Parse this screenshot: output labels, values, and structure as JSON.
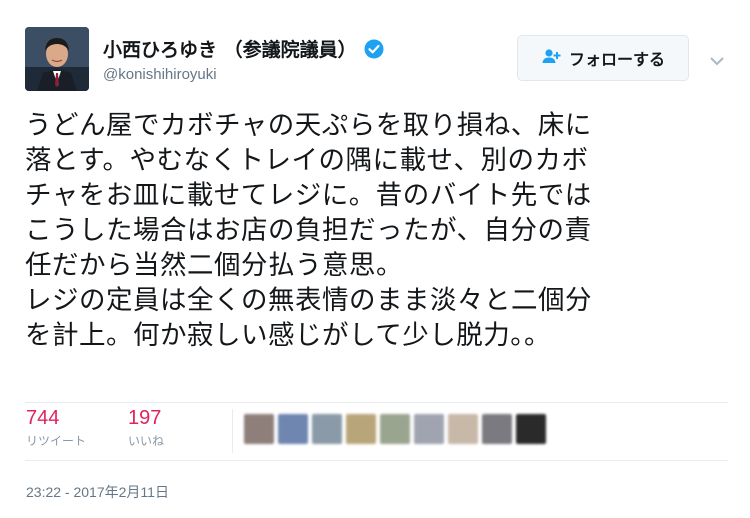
{
  "user": {
    "name": "小西ひろゆき （参議院議員）",
    "handle": "@konishihiroyuki",
    "verified": true
  },
  "follow_button": {
    "label": "フォローする",
    "icon": "add-user-icon"
  },
  "tweet": {
    "lines": [
      "うどん屋でカボチャの天ぷらを取り損ね、床に",
      "落とす。やむなくトレイの隅に載せ、別のカボ",
      "チャをお皿に載せてレジに。昔のバイト先では",
      "こうした場合はお店の負担だったが、自分の責",
      "任だから当然二個分払う意思。",
      "レジの定員は全くの無表情のまま淡々と二個分",
      "を計上。何か寂しい感じがして少し脱力。。"
    ]
  },
  "stats": {
    "retweets": {
      "count": "744",
      "label": "リツイート"
    },
    "likes": {
      "count": "197",
      "label": "いいね"
    }
  },
  "liker_avatars": {
    "count": 9,
    "colors": [
      "#8e7f7a",
      "#6f86b0",
      "#8a9aa8",
      "#b9a57a",
      "#9aa590",
      "#a0a4b0",
      "#c8b8a8",
      "#7a7a80",
      "#2a2a2a"
    ]
  },
  "timestamp": "23:22 - 2017年2月11日",
  "colors": {
    "accent_like": "#e0245e",
    "verified_blue": "#1da1f2",
    "muted_text": "#657786"
  }
}
